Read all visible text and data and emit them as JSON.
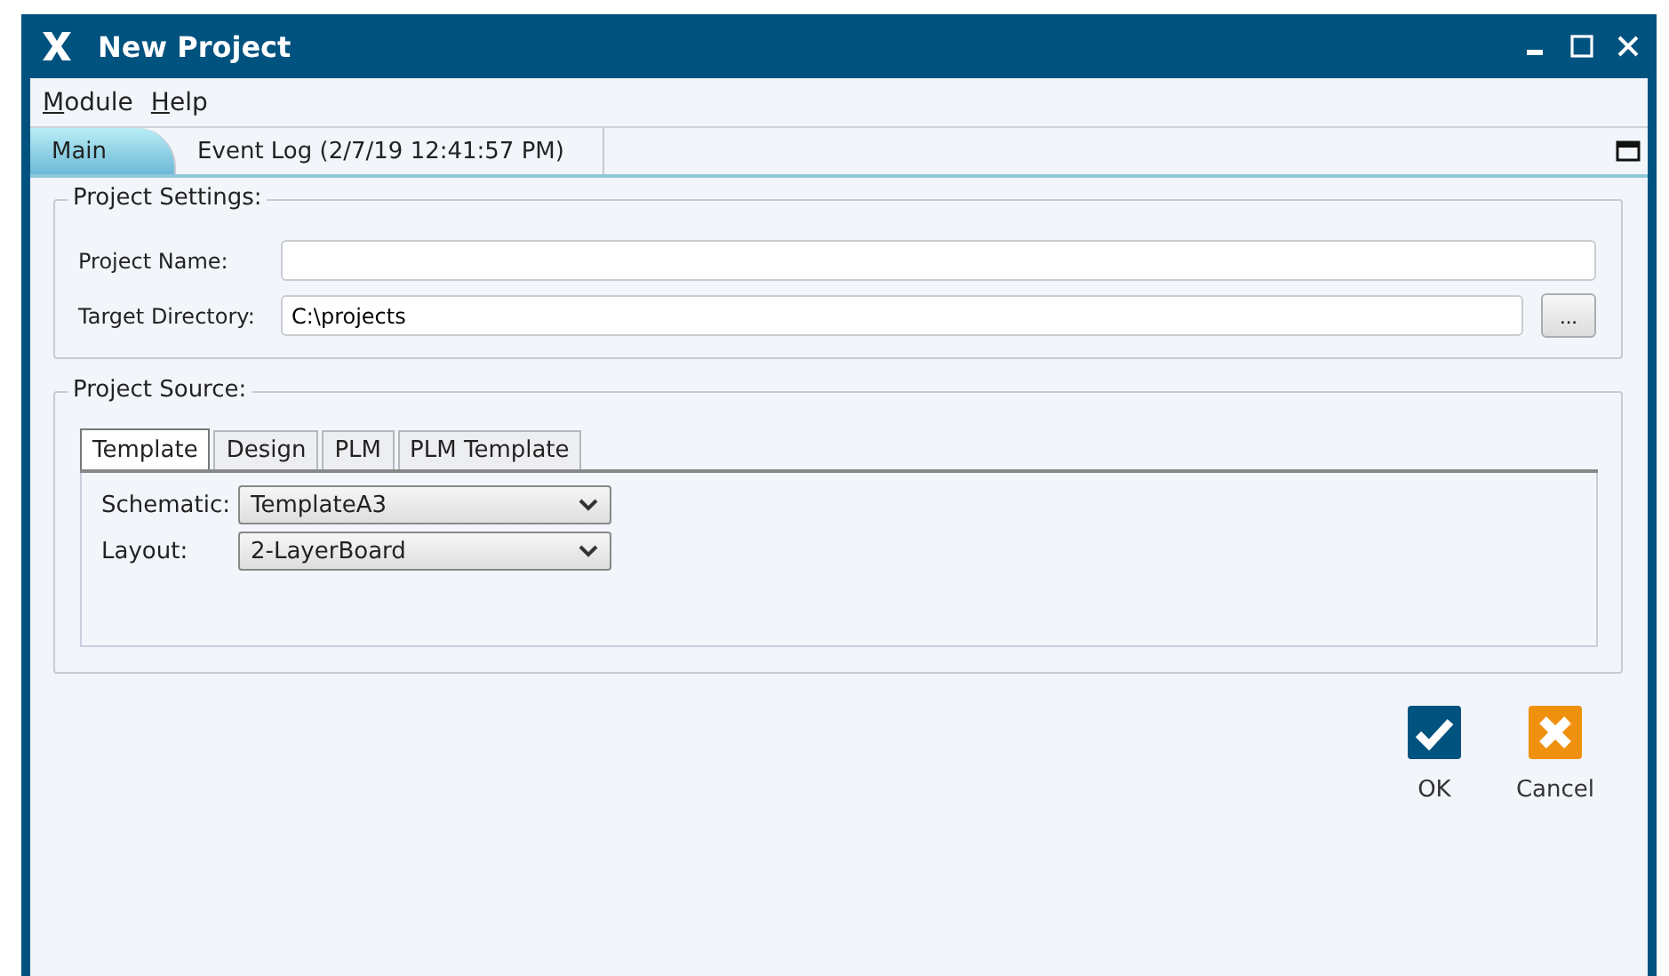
{
  "window": {
    "title": "New Project"
  },
  "menu": [
    "Module",
    "Help"
  ],
  "tabs": [
    {
      "label": "Main",
      "selected": true
    },
    {
      "label": "Event Log (2/7/19 12:41:57 PM)",
      "selected": false
    }
  ],
  "project_settings": {
    "title": "Project Settings:",
    "fields": [
      {
        "label": "Project Name:"
      },
      {
        "label": "Target Directory:",
        "value": "C:\\projects",
        "browse": "..."
      }
    ]
  },
  "project_source": {
    "title": "Project Source:",
    "tabs": [
      {
        "label": "Template",
        "selected": true
      },
      {
        "label": "Design",
        "selected": false
      },
      {
        "label": "PLM",
        "selected": false
      },
      {
        "label": "PLM Template",
        "selected": false
      }
    ],
    "dropdowns": [
      {
        "label": "Schematic:",
        "value": "TemplateA3"
      },
      {
        "label": "Layout:",
        "value": "2-LayerBoard"
      }
    ]
  },
  "buttons": [
    {
      "kind": "ok",
      "label": "OK"
    },
    {
      "kind": "cancel",
      "label": "Cancel"
    }
  ]
}
